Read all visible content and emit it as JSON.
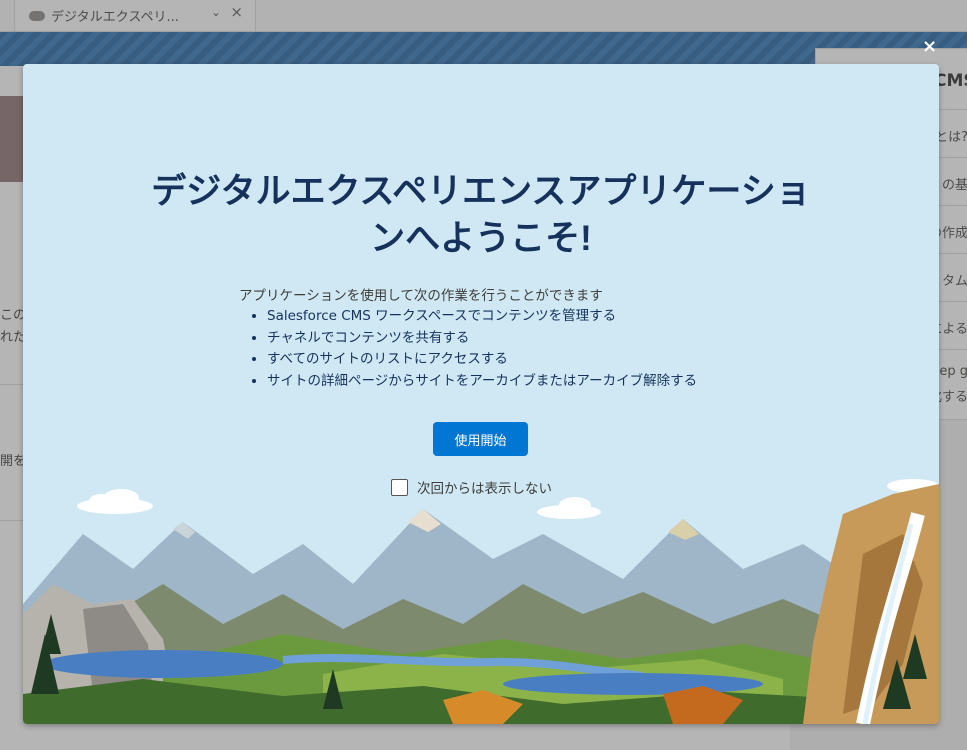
{
  "background": {
    "tab": {
      "label": "デジタルエクスペリ...",
      "icon": "cloud-icon"
    },
    "left_texts": [
      "この",
      "れた",
      "開を"
    ],
    "right_panel": {
      "title": "CMS",
      "items": [
        "とは?",
        "の基",
        "の作成",
        "タム",
        "による",
        "tep g",
        "化する"
      ]
    }
  },
  "modal": {
    "close_label": "×",
    "title": "デジタルエクスペリエンスアプリケーションへようこそ!",
    "intro": "アプリケーションを使用して次の作業を行うことができます",
    "features": [
      "Salesforce CMS ワークスペースでコンテンツを管理する",
      "チャネルでコンテンツを共有する",
      "すべてのサイトのリストにアクセスする",
      "サイトの詳細ページからサイトをアーカイブまたはアーカイブ解除する"
    ],
    "start_button": "使用開始",
    "dont_show_label": "次回からは表示しない",
    "dont_show_checked": false
  },
  "colors": {
    "modal_bg": "#cfe8f3",
    "title": "#16325c",
    "brand_button": "#0176d3"
  }
}
